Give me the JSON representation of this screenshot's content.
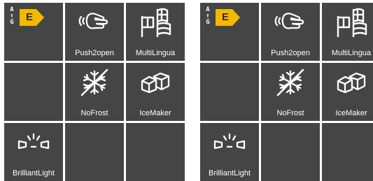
{
  "energy_label": {
    "scale_top": "A",
    "scale_bottom": "G",
    "class": "E",
    "class_color": "#f5b800"
  },
  "features": {
    "push2open": "Push2open",
    "multilingua": "MultiLingua",
    "nofrost": "NoFrost",
    "icemaker": "IceMaker",
    "brilliantlight": "BrilliantLight"
  },
  "colors": {
    "tile_background": "#454545",
    "icon_and_text": "#ffffff"
  }
}
